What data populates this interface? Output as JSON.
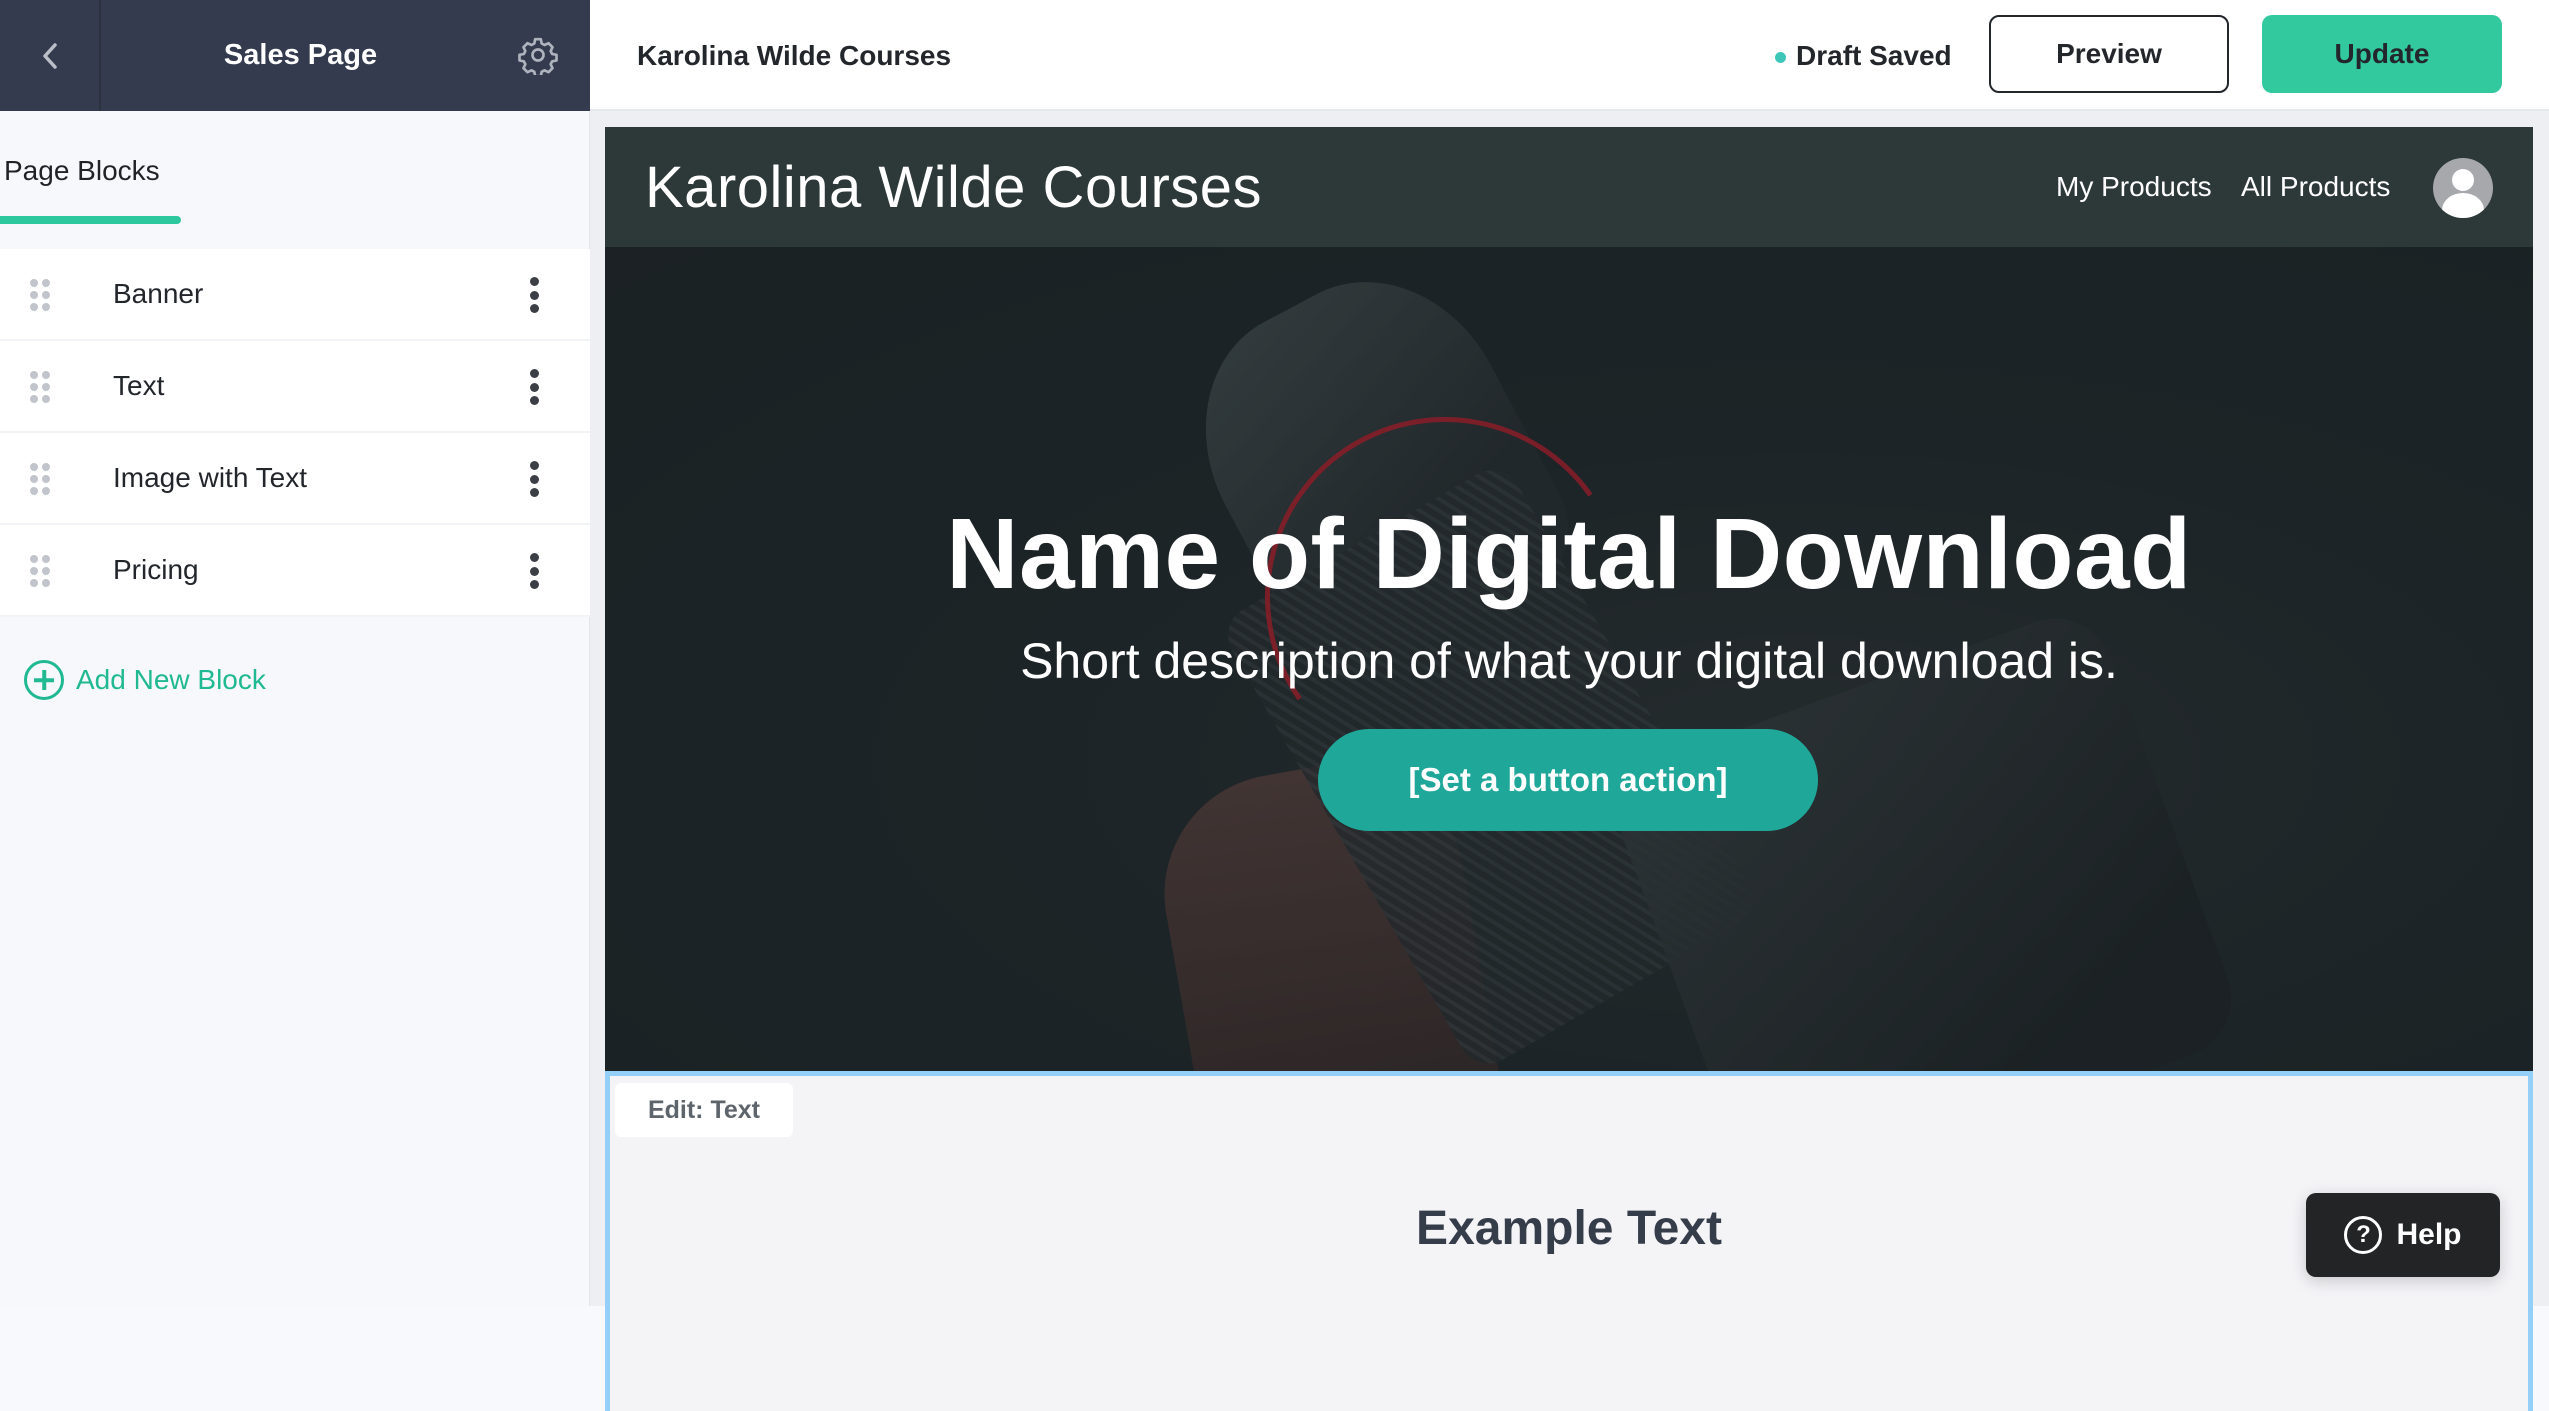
{
  "sidebar": {
    "title": "Sales Page",
    "back_icon": "chevron-left-icon",
    "settings_icon": "gear-icon",
    "tab_label": "Page Blocks",
    "blocks": [
      {
        "label": "Banner"
      },
      {
        "label": "Text"
      },
      {
        "label": "Image with Text"
      },
      {
        "label": "Pricing"
      }
    ],
    "add_block_label": "Add New Block"
  },
  "header": {
    "site_name": "Karolina Wilde Courses",
    "status": "Draft Saved",
    "status_color": "#3ec6b9",
    "preview_label": "Preview",
    "update_label": "Update",
    "accent_color": "#33c99f"
  },
  "preview": {
    "nav": {
      "logo": "Karolina Wilde Courses",
      "links": [
        "My Products",
        "All Products"
      ]
    },
    "hero": {
      "title": "Name of Digital Download",
      "subtitle": "Short description of what your digital download is.",
      "cta_label": "[Set a button action]"
    },
    "text_block": {
      "edit_tag": "Edit: Text",
      "heading": "Example Text"
    }
  },
  "help": {
    "label": "Help",
    "icon_glyph": "?"
  }
}
